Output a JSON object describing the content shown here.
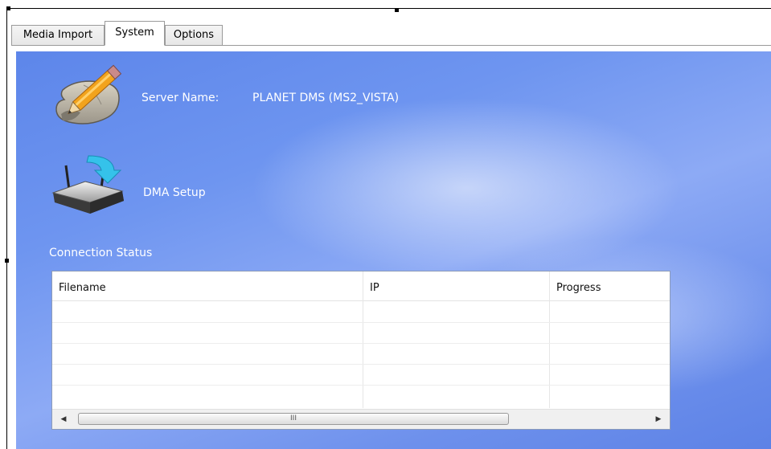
{
  "tabs": [
    {
      "label": "Media Import"
    },
    {
      "label": "System"
    },
    {
      "label": "Options"
    }
  ],
  "active_tab": "System",
  "server": {
    "label": "Server Name:",
    "value": "PLANET DMS (MS2_VISTA)",
    "icon": "pencil-paper-icon"
  },
  "dma": {
    "label": "DMA Setup",
    "icon": "router-download-icon"
  },
  "connection": {
    "heading": "Connection Status",
    "columns": [
      "Filename",
      "IP",
      "Progress"
    ],
    "rows": [],
    "scroll_grip": "III"
  },
  "colors": {
    "panel_blue": "#6e95f0",
    "text_white": "#ffffff"
  }
}
